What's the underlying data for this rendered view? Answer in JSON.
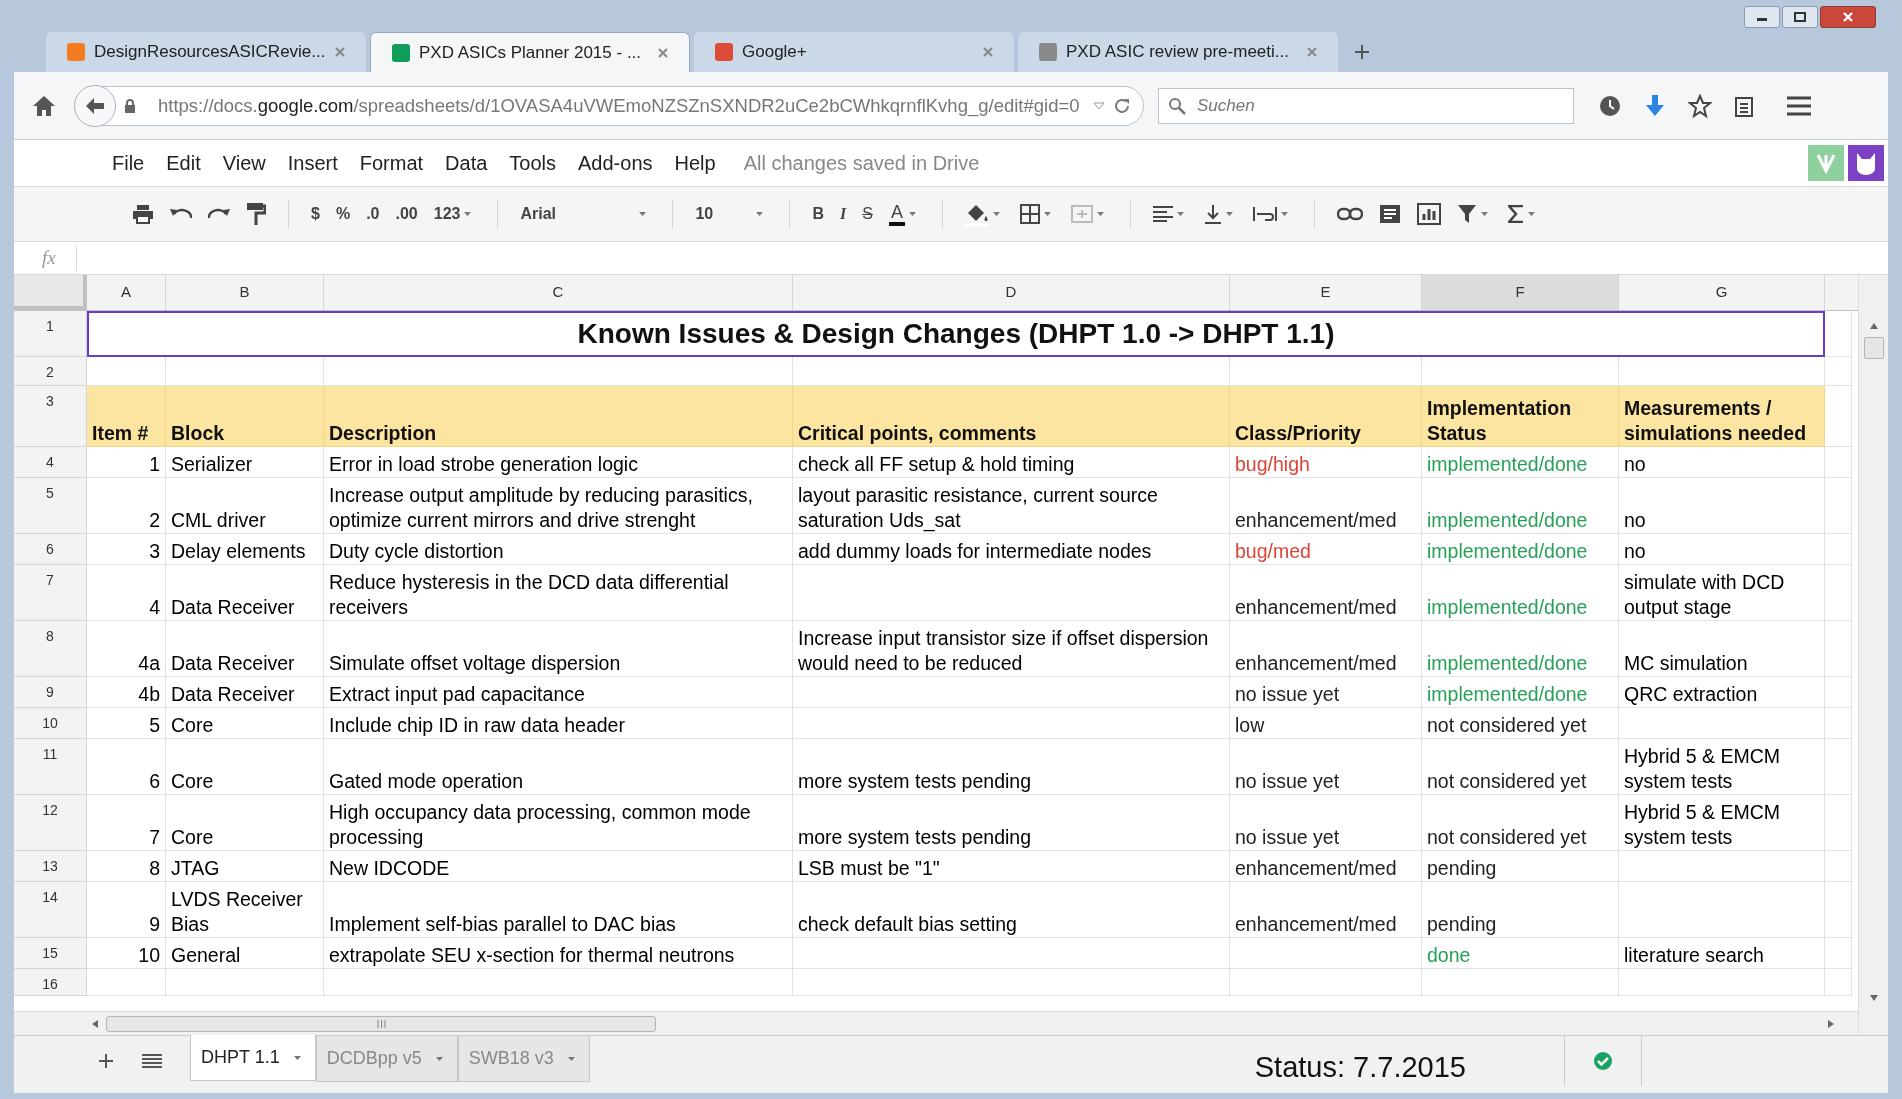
{
  "browser_tabs": [
    {
      "title": "DesignResourcesASICRevie...",
      "selected": false,
      "color": "#f47c20"
    },
    {
      "title": "PXD ASICs Planner 2015 - ...",
      "selected": true,
      "color": "#0f9d58"
    },
    {
      "title": "Google+",
      "selected": false,
      "color": "#dd4b39"
    },
    {
      "title": "PXD ASIC review pre-meeti...",
      "selected": false,
      "color": "#8a8a8a"
    }
  ],
  "address_bar": {
    "url": "https://docs.**google.com**/spreadsheets/d/1OVASA4uVWEmoNZSZnSXNDR2uCe2bCWhkqrnflKvhg_g/edit#gid=0"
  },
  "search": {
    "placeholder": "Suchen"
  },
  "menu": [
    "File",
    "Edit",
    "View",
    "Insert",
    "Format",
    "Data",
    "Tools",
    "Add-ons",
    "Help"
  ],
  "save_status": "All changes saved in Drive",
  "toolbar": {
    "currency": "$",
    "percent": "%",
    "decimals_less": ".0",
    "decimals_more": ".00",
    "number_format": "123",
    "font": "Arial",
    "font_size": "10",
    "bold": "B",
    "italic": "I",
    "strikethrough": "S",
    "text_color": "A"
  },
  "formula_bar": {
    "label": "fx"
  },
  "columns": [
    {
      "label": "A",
      "selected": false
    },
    {
      "label": "B",
      "selected": false
    },
    {
      "label": "C",
      "selected": false
    },
    {
      "label": "D",
      "selected": false
    },
    {
      "label": "E",
      "selected": false
    },
    {
      "label": "F",
      "selected": true
    },
    {
      "label": "G",
      "selected": false
    }
  ],
  "rows": [
    {
      "kind": "title",
      "number": "1",
      "text": "Known Issues & Design Changes (DHPT 1.0 -> DHPT 1.1)"
    },
    {
      "kind": "blank",
      "number": "2"
    },
    {
      "kind": "header",
      "number": "3",
      "cells": [
        "Item #",
        "Block",
        "Description",
        "Critical points, comments",
        "Class/Priority",
        "Implementation Status",
        "Measurements / simulations needed"
      ]
    },
    {
      "kind": "data",
      "number": "4",
      "item": "1",
      "block": "Serializer",
      "description": "Error in load strobe generation logic",
      "comments": "check all FF setup & hold timing",
      "class": {
        "text": "bug/high",
        "color": "#db4437"
      },
      "status": {
        "text": "implemented/done",
        "color": "#27a05a"
      },
      "measurements": "no"
    },
    {
      "kind": "data",
      "number": "5",
      "item": "2",
      "block": "CML driver",
      "description": "Increase output amplitude by reducing parasitics, optimize current mirrors and drive strenght",
      "comments": "layout parasitic resistance, current source saturation Uds_sat",
      "class": {
        "text": "enhancement/med",
        "color": "#222222"
      },
      "status": {
        "text": "implemented/done",
        "color": "#27a05a"
      },
      "measurements": "no"
    },
    {
      "kind": "data",
      "number": "6",
      "item": "3",
      "block": "Delay elements",
      "description": "Duty cycle distortion",
      "comments": "add dummy loads for intermediate nodes",
      "class": {
        "text": "bug/med",
        "color": "#db4437"
      },
      "status": {
        "text": "implemented/done",
        "color": "#27a05a"
      },
      "measurements": "no"
    },
    {
      "kind": "data",
      "number": "7",
      "item": "4",
      "block": "Data Receiver",
      "description": "Reduce hysteresis in the DCD data differential receivers",
      "class": {
        "text": "enhancement/med",
        "color": "#222222"
      },
      "status": {
        "text": "implemented/done",
        "color": "#27a05a"
      },
      "measurements": "simulate with DCD output stage"
    },
    {
      "kind": "data",
      "number": "8",
      "item": "4a",
      "block": "Data Receiver",
      "description": "Simulate offset voltage dispersion",
      "comments": "Increase input transistor size if offset dispersion would need to be reduced",
      "class": {
        "text": "enhancement/med",
        "color": "#222222"
      },
      "status": {
        "text": "implemented/done",
        "color": "#27a05a"
      },
      "measurements": "MC simulation"
    },
    {
      "kind": "data",
      "number": "9",
      "item": "4b",
      "block": "Data Receiver",
      "description": "Extract input pad capacitance",
      "class": {
        "text": "no issue yet",
        "color": "#222222"
      },
      "status": {
        "text": "implemented/done",
        "color": "#27a05a"
      },
      "measurements": "QRC extraction"
    },
    {
      "kind": "data",
      "number": "10",
      "item": "5",
      "block": "Core",
      "description": "Include chip ID in raw data header",
      "class": {
        "text": "low",
        "color": "#222222"
      },
      "status": {
        "text": "not considered yet",
        "color": "#222222"
      }
    },
    {
      "kind": "data",
      "number": "11",
      "item": "6",
      "block": "Core",
      "description": "Gated mode operation",
      "comments": "more system tests pending",
      "class": {
        "text": "no issue yet",
        "color": "#222222"
      },
      "status": {
        "text": "not considered yet",
        "color": "#222222"
      },
      "measurements": "Hybrid 5 & EMCM system tests"
    },
    {
      "kind": "data",
      "number": "12",
      "item": "7",
      "block": "Core",
      "description": "High occupancy data processing, common mode processing",
      "comments": "more system tests pending",
      "class": {
        "text": "no issue yet",
        "color": "#222222"
      },
      "status": {
        "text": "not considered yet",
        "color": "#222222"
      },
      "measurements": "Hybrid 5 & EMCM system tests"
    },
    {
      "kind": "data",
      "number": "13",
      "item": "8",
      "block": "JTAG",
      "description": "New IDCODE",
      "comments": "LSB must be \"1\"",
      "class": {
        "text": "enhancement/med",
        "color": "#222222"
      },
      "status": {
        "text": "pending",
        "color": "#222222"
      }
    },
    {
      "kind": "data",
      "number": "14",
      "item": "9",
      "block": "LVDS Receiver Bias",
      "description": "Implement self-bias parallel to DAC bias",
      "comments": "check default bias setting",
      "class": {
        "text": "enhancement/med",
        "color": "#222222"
      },
      "status": {
        "text": "pending",
        "color": "#222222"
      }
    },
    {
      "kind": "data",
      "number": "15",
      "item": "10",
      "block": "General",
      "description": "extrapolate SEU x-section for thermal neutrons",
      "status": {
        "text": "done",
        "color": "#27a05a"
      },
      "measurements": "literature search"
    },
    {
      "kind": "blank",
      "number": "16"
    }
  ],
  "sheet_tabs": [
    {
      "label": "DHPT 1.1",
      "selected": true
    },
    {
      "label": "DCDBpp v5",
      "selected": false
    },
    {
      "label": "SWB18 v3",
      "selected": false
    }
  ],
  "status_note": "Status: 7.7.2015"
}
